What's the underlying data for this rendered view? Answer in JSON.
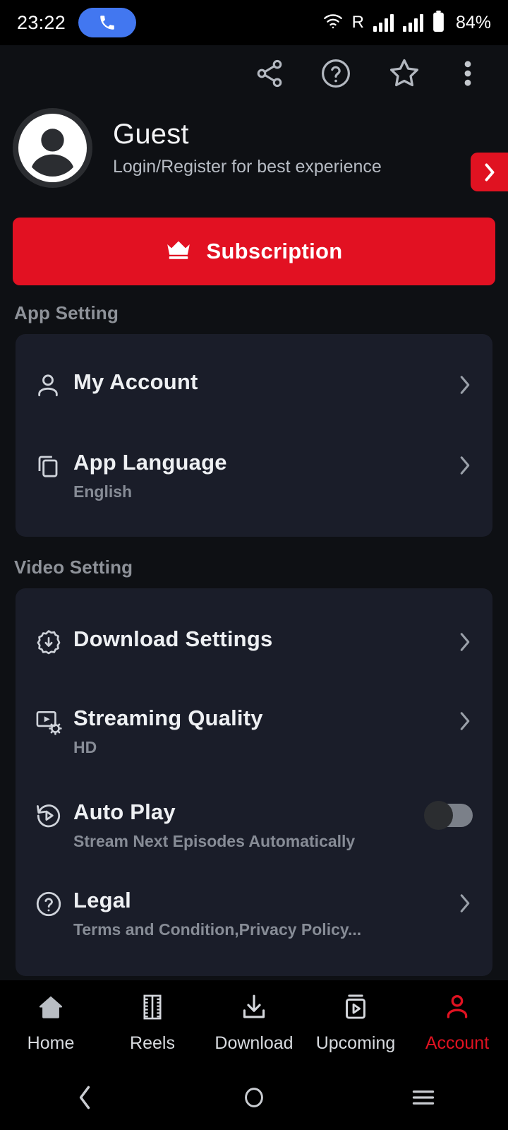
{
  "status_bar": {
    "time": "23:22",
    "call_icon": "phone-icon",
    "wifi_icon": "wifi-icon",
    "roaming": "R",
    "signal_icon_1": "signal-bars-icon",
    "signal_icon_2": "signal-bars-icon",
    "battery_icon": "battery-icon",
    "battery": "84%"
  },
  "appbar": {
    "share": "share-icon",
    "help": "help-circle-icon",
    "favorite": "star-icon",
    "more": "more-vertical-icon"
  },
  "profile": {
    "avatar_icon": "avatar-person-icon",
    "name": "Guest",
    "subtitle": "Login/Register for best experience",
    "cta_icon": "chevron-right-icon"
  },
  "subscription": {
    "icon": "crown-icon",
    "label": "Subscription"
  },
  "sections": [
    {
      "title": "App Setting",
      "rows": [
        {
          "icon": "person-outline-icon",
          "title": "My Account",
          "subtitle": "",
          "accessory": "chevron-right-icon"
        },
        {
          "icon": "copy-layers-icon",
          "title": "App Language",
          "subtitle": "English",
          "accessory": "chevron-right-icon"
        }
      ]
    },
    {
      "title": "Video Setting",
      "rows": [
        {
          "icon": "gear-download-icon",
          "title": "Download Settings",
          "subtitle": "",
          "accessory": "chevron-right-icon"
        },
        {
          "icon": "video-quality-icon",
          "title": "Streaming Quality",
          "subtitle": "HD",
          "accessory": "chevron-right-icon"
        },
        {
          "icon": "replay-play-icon",
          "title": "Auto Play",
          "subtitle": "Stream Next Episodes Automatically",
          "accessory": "toggle-off"
        },
        {
          "icon": "question-circle-icon",
          "title": "Legal",
          "subtitle": "Terms and Condition,Privacy Policy...",
          "accessory": "chevron-right-icon"
        }
      ]
    }
  ],
  "bottom_nav": {
    "items": [
      {
        "label": "Home",
        "icon": "home-icon",
        "active": false
      },
      {
        "label": "Reels",
        "icon": "film-strip-icon",
        "active": false
      },
      {
        "label": "Download",
        "icon": "download-icon",
        "active": false
      },
      {
        "label": "Upcoming",
        "icon": "upcoming-video-icon",
        "active": false
      },
      {
        "label": "Account",
        "icon": "account-person-icon",
        "active": true
      }
    ]
  },
  "android_nav": {
    "back": "back-chevron-icon",
    "home": "home-circle-icon",
    "recents": "recents-menu-icon"
  },
  "colors": {
    "accent_red": "#e01221",
    "page_bg": "#0e1014",
    "card_bg": "#1a1d29",
    "muted_text": "#8e9299"
  }
}
